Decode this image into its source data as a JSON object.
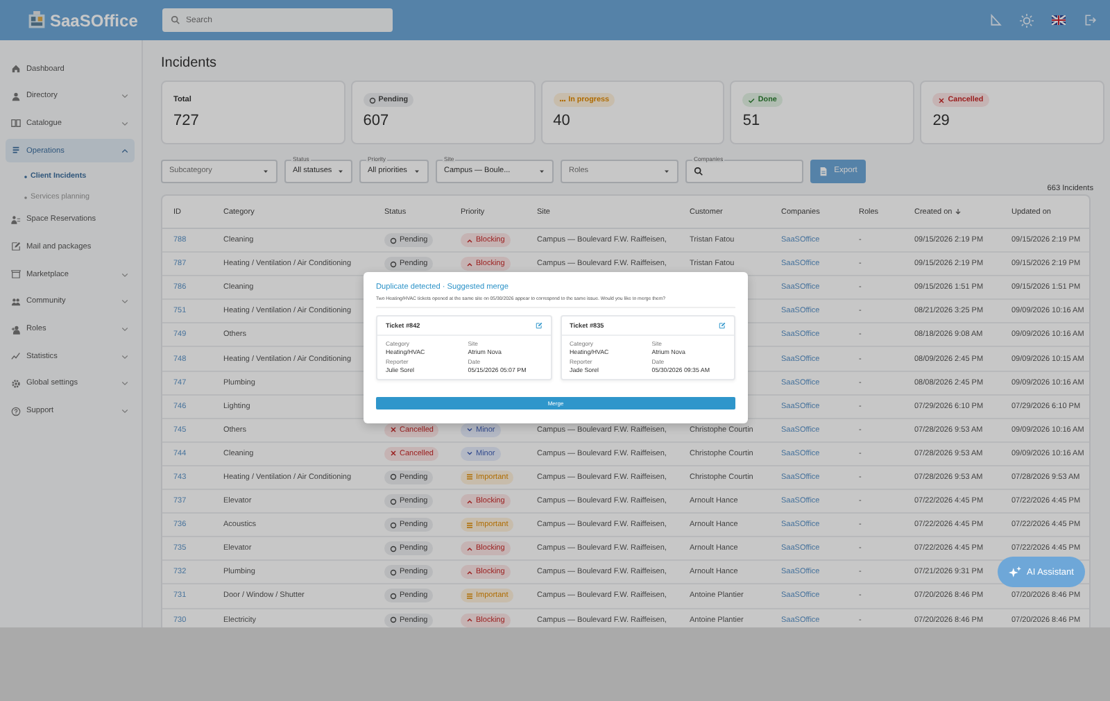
{
  "header": {
    "logo": "SaaSOffice",
    "search": {
      "placeholder": "Search"
    }
  },
  "sidebar": {
    "items": [
      {
        "label": "Dashboard",
        "expandable": false,
        "selected": false
      },
      {
        "label": "Directory",
        "expandable": true,
        "expanded": false,
        "selected": false
      },
      {
        "label": "Catalogue",
        "expandable": true,
        "expanded": false,
        "selected": false
      },
      {
        "label": "Operations",
        "expandable": true,
        "expanded": true,
        "selected": true,
        "children": [
          {
            "label": "Client Incidents",
            "selected": true
          },
          {
            "label": "Services planning",
            "selected": false
          }
        ]
      },
      {
        "label": "Space Reservations",
        "expandable": false,
        "selected": false
      },
      {
        "label": "Mail and packages",
        "expandable": false,
        "selected": false
      },
      {
        "label": "Marketplace",
        "expandable": true,
        "expanded": false,
        "selected": false
      },
      {
        "label": "Community",
        "expandable": true,
        "expanded": false,
        "selected": false
      },
      {
        "label": "Roles",
        "expandable": true,
        "expanded": false,
        "selected": false
      },
      {
        "label": "Statistics",
        "expandable": true,
        "expanded": false,
        "selected": false
      },
      {
        "label": "Global settings",
        "expandable": true,
        "expanded": false,
        "selected": false
      },
      {
        "label": "Support",
        "expandable": true,
        "expanded": false,
        "selected": false
      }
    ]
  },
  "page_title": "Incidents",
  "stats": [
    {
      "label": "Total",
      "value": "727",
      "kind": "plain"
    },
    {
      "label": "Pending",
      "value": "607",
      "kind": "pending"
    },
    {
      "label": "In progress",
      "value": "40",
      "kind": "progress"
    },
    {
      "label": "Done",
      "value": "51",
      "kind": "done"
    },
    {
      "label": "Cancelled",
      "value": "29",
      "kind": "cancelled"
    }
  ],
  "filters": [
    {
      "kind": "select",
      "placeholder": "Subcategory"
    },
    {
      "kind": "select",
      "label": "Status",
      "value": "All statuses"
    },
    {
      "kind": "select",
      "label": "Priority",
      "value": "All priorities"
    },
    {
      "kind": "select",
      "label": "Site",
      "value": "Campus — Boule..."
    },
    {
      "kind": "select",
      "placeholder": "Roles"
    },
    {
      "kind": "search",
      "label": "Companies"
    }
  ],
  "export_button": "Export",
  "count": "663 Incidents",
  "table": {
    "columns": [
      {
        "label": "ID",
        "sorted": false
      },
      {
        "label": "Category",
        "sorted": false
      },
      {
        "label": "Status",
        "sorted": false
      },
      {
        "label": "Priority",
        "sorted": false
      },
      {
        "label": "Site",
        "sorted": false
      },
      {
        "label": "Customer",
        "sorted": false
      },
      {
        "label": "Companies",
        "sorted": false
      },
      {
        "label": "Roles",
        "sorted": false
      },
      {
        "label": "Created on",
        "sorted": true
      },
      {
        "label": "Updated on",
        "sorted": false
      }
    ],
    "rows": [
      {
        "id": "788",
        "category": "Cleaning",
        "status": {
          "label": "Pending",
          "kind": "pending"
        },
        "priority": {
          "label": "Blocking",
          "kind": "blocking"
        },
        "site": "Campus — Boulevard F.W. Raiffeisen,",
        "customer": "Tristan Fatou",
        "companies": "SaaSOffice",
        "roles": "-",
        "created": "09/15/2026 2:19 PM",
        "updated": "09/15/2026 2:19 PM"
      },
      {
        "id": "787",
        "category": "Heating / Ventilation / Air Conditioning",
        "status": {
          "label": "Pending",
          "kind": "pending"
        },
        "priority": {
          "label": "Blocking",
          "kind": "blocking"
        },
        "site": "Campus — Boulevard F.W. Raiffeisen,",
        "customer": "Tristan Fatou",
        "companies": "SaaSOffice",
        "roles": "-",
        "created": "09/15/2026 2:19 PM",
        "updated": "09/15/2026 2:19 PM"
      },
      {
        "id": "786",
        "category": "Cleaning",
        "companies": "SaaSOffice",
        "roles": "-",
        "created": "09/15/2026 1:51 PM",
        "updated": "09/15/2026 1:51 PM"
      },
      {
        "id": "751",
        "category": "Heating / Ventilation / Air Conditioning",
        "companies": "SaaSOffice",
        "roles": "-",
        "created": "08/21/2026 3:25 PM",
        "updated": "09/09/2026 10:16 AM"
      },
      {
        "id": "749",
        "category": "Others",
        "companies": "SaaSOffice",
        "roles": "-",
        "created": "08/18/2026 9:08 AM",
        "updated": "09/09/2026 10:16 AM"
      },
      {
        "id": "748",
        "category": "Heating / Ventilation / Air Conditioning",
        "companies": "SaaSOffice",
        "roles": "-",
        "created": "08/09/2026 2:45 PM",
        "updated": "09/09/2026 10:15 AM"
      },
      {
        "id": "747",
        "category": "Plumbing",
        "companies": "SaaSOffice",
        "roles": "-",
        "created": "08/08/2026 2:45 PM",
        "updated": "09/09/2026 10:16 AM"
      },
      {
        "id": "746",
        "category": "Lighting",
        "companies": "SaaSOffice",
        "roles": "-",
        "created": "07/29/2026 6:10 PM",
        "updated": "07/29/2026 6:10 PM"
      },
      {
        "id": "745",
        "category": "Others",
        "status": {
          "label": "Cancelled",
          "kind": "cancelled"
        },
        "priority": {
          "label": "Minor",
          "kind": "minor"
        },
        "site": "Campus — Boulevard F.W. Raiffeisen,",
        "customer": "Christophe Courtin",
        "companies": "SaaSOffice",
        "roles": "-",
        "created": "07/28/2026 9:53 AM",
        "updated": "09/09/2026 10:16 AM"
      },
      {
        "id": "744",
        "category": "Cleaning",
        "status": {
          "label": "Cancelled",
          "kind": "cancelled"
        },
        "priority": {
          "label": "Minor",
          "kind": "minor"
        },
        "site": "Campus — Boulevard F.W. Raiffeisen,",
        "customer": "Christophe Courtin",
        "companies": "SaaSOffice",
        "roles": "-",
        "created": "07/28/2026 9:53 AM",
        "updated": "09/09/2026 10:16 AM"
      },
      {
        "id": "743",
        "category": "Heating / Ventilation / Air Conditioning",
        "status": {
          "label": "Pending",
          "kind": "pending"
        },
        "priority": {
          "label": "Important",
          "kind": "important"
        },
        "site": "Campus — Boulevard F.W. Raiffeisen,",
        "customer": "Christophe Courtin",
        "companies": "SaaSOffice",
        "roles": "-",
        "created": "07/28/2026 9:53 AM",
        "updated": "07/28/2026 9:53 AM"
      },
      {
        "id": "737",
        "category": "Elevator",
        "status": {
          "label": "Pending",
          "kind": "pending"
        },
        "priority": {
          "label": "Blocking",
          "kind": "blocking"
        },
        "site": "Campus — Boulevard F.W. Raiffeisen,",
        "customer": "Arnoult Hance",
        "companies": "SaaSOffice",
        "roles": "-",
        "created": "07/22/2026 4:45 PM",
        "updated": "07/22/2026 4:45 PM"
      },
      {
        "id": "736",
        "category": "Acoustics",
        "status": {
          "label": "Pending",
          "kind": "pending"
        },
        "priority": {
          "label": "Important",
          "kind": "important"
        },
        "site": "Campus — Boulevard F.W. Raiffeisen,",
        "customer": "Arnoult Hance",
        "companies": "SaaSOffice",
        "roles": "-",
        "created": "07/22/2026 4:45 PM",
        "updated": "07/22/2026 4:45 PM"
      },
      {
        "id": "735",
        "category": "Elevator",
        "status": {
          "label": "Pending",
          "kind": "pending"
        },
        "priority": {
          "label": "Blocking",
          "kind": "blocking"
        },
        "site": "Campus — Boulevard F.W. Raiffeisen,",
        "customer": "Arnoult Hance",
        "companies": "SaaSOffice",
        "roles": "-",
        "created": "07/22/2026 4:45 PM",
        "updated": "07/22/2026 4:45 PM"
      },
      {
        "id": "732",
        "category": "Plumbing",
        "status": {
          "label": "Pending",
          "kind": "pending"
        },
        "priority": {
          "label": "Blocking",
          "kind": "blocking"
        },
        "site": "Campus — Boulevard F.W. Raiffeisen,",
        "customer": "Arnoult Hance",
        "companies": "SaaSOffice",
        "roles": "-",
        "created": "07/21/2026 9:31 PM"
      },
      {
        "id": "731",
        "category": "Door / Window / Shutter",
        "status": {
          "label": "Pending",
          "kind": "pending"
        },
        "priority": {
          "label": "Important",
          "kind": "important"
        },
        "site": "Campus — Boulevard F.W. Raiffeisen,",
        "customer": "Antoine Plantier",
        "companies": "SaaSOffice",
        "roles": "-",
        "created": "07/20/2026 8:46 PM",
        "updated": "07/20/2026 8:46 PM"
      },
      {
        "id": "730",
        "category": "Electricity",
        "status": {
          "label": "Pending",
          "kind": "pending"
        },
        "priority": {
          "label": "Blocking",
          "kind": "blocking"
        },
        "site": "Campus — Boulevard F.W. Raiffeisen,",
        "customer": "Antoine Plantier",
        "companies": "SaaSOffice",
        "roles": "-",
        "created": "07/20/2026 8:46 PM",
        "updated": "07/20/2026 8:46 PM"
      }
    ]
  },
  "dialog": {
    "title": "Duplicate detected · Suggested merge",
    "message": "Two Heating/HVAC tickets opened at the same site on 05/30/2026 appear to correspond to the same issue. Would you like to merge them?",
    "tickets": [
      {
        "title": "Ticket #842",
        "fields": [
          {
            "label": "Category",
            "value": "Heating/HVAC"
          },
          {
            "label": "Site",
            "value": "Atrium Nova"
          },
          {
            "label": "Reporter",
            "value": "Julie Sorel"
          },
          {
            "label": "Date",
            "value": "05/15/2026 05:07 PM"
          }
        ]
      },
      {
        "title": "Ticket #835",
        "fields": [
          {
            "label": "Category",
            "value": "Heating/HVAC"
          },
          {
            "label": "Site",
            "value": "Atrium Nova"
          },
          {
            "label": "Reporter",
            "value": "Jade Sorel"
          },
          {
            "label": "Date",
            "value": "05/30/2026 09:35 AM"
          }
        ]
      }
    ],
    "button": "Merge"
  },
  "assistant_button": "AI Assistant"
}
